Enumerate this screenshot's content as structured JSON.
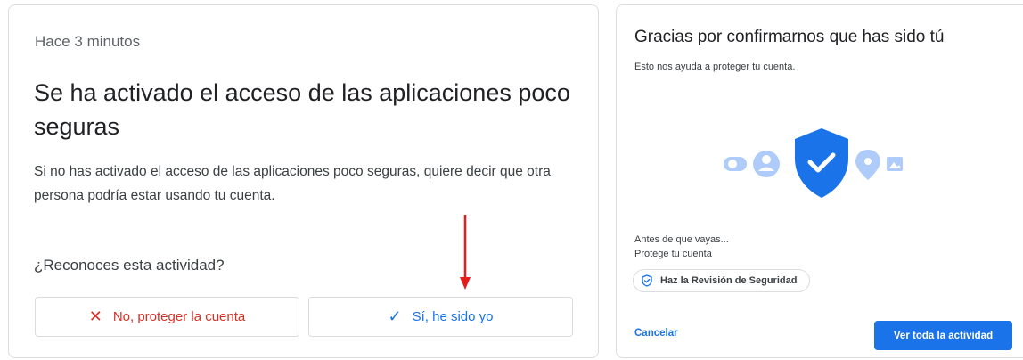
{
  "alert": {
    "timestamp": "Hace 3 minutos",
    "title": "Se ha activado el acceso de las aplicaciones poco seguras",
    "description": "Si no has activado el acceso de las aplicaciones poco seguras, quiere decir que otra persona podría estar usando tu cuenta.",
    "question": "¿Reconoces esta actividad?",
    "deny_button": {
      "icon": "x-icon",
      "label": "No, proteger la cuenta",
      "color": "#d93025"
    },
    "confirm_button": {
      "icon": "check-icon",
      "label": "Sí, he sido yo",
      "color": "#1a73e8"
    },
    "annotation": {
      "type": "arrow-down",
      "color": "#e51c1c"
    }
  },
  "confirmation": {
    "title": "Gracias por confirmarnos que has sido tú",
    "subtitle": "Esto nos ayuda a proteger tu cuenta.",
    "illustration": [
      "toggle-icon",
      "person-icon",
      "shield-check-icon",
      "location-pin-icon",
      "image-icon"
    ],
    "before_line1": "Antes de que vayas...",
    "before_line2": "Protege tu cuenta",
    "security_chip": {
      "icon": "shield-check-icon",
      "label": "Haz la Revisión de Seguridad"
    },
    "cancel_label": "Cancelar",
    "primary_label": "Ver toda la actividad",
    "accent": "#1a73e8"
  }
}
